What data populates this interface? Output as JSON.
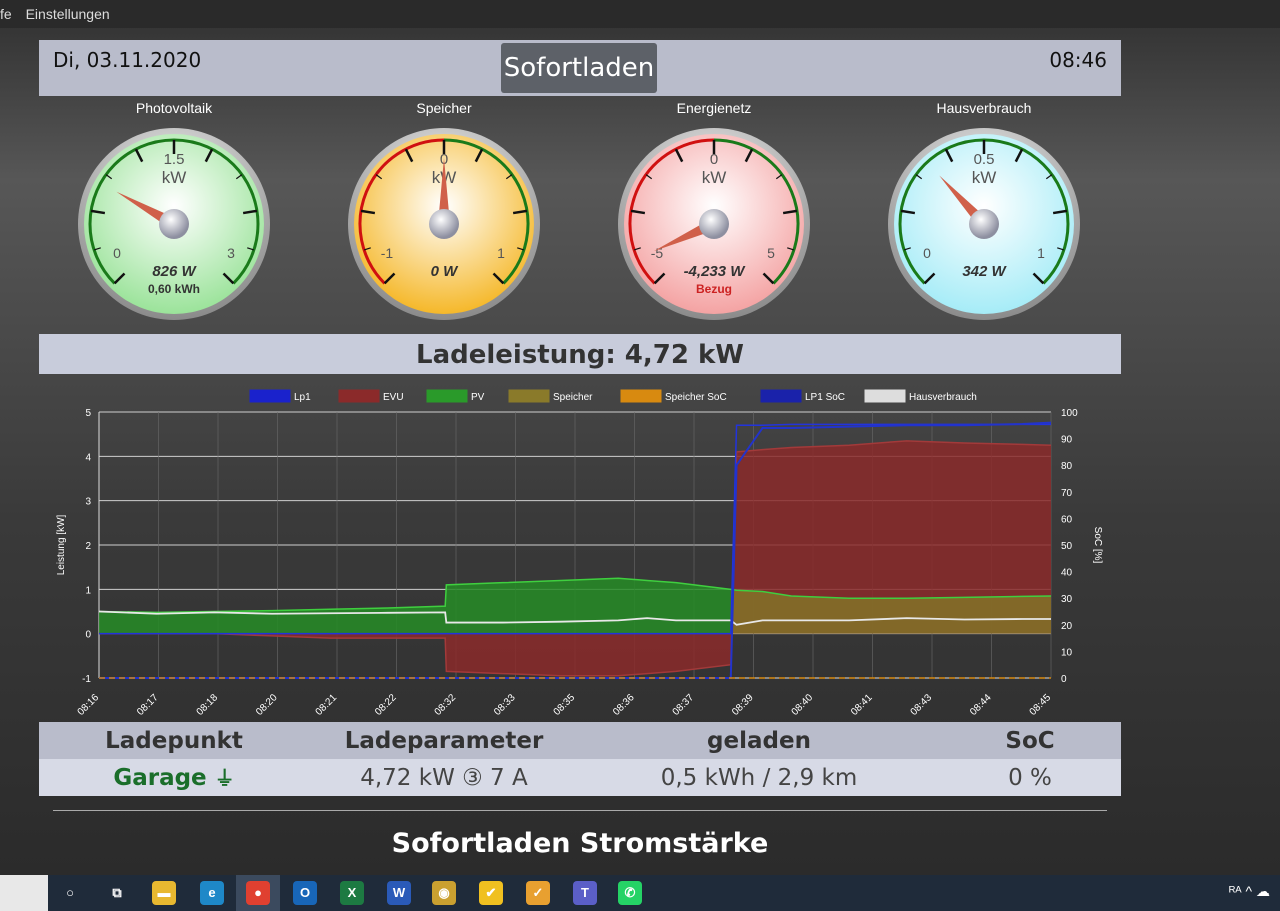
{
  "menu": {
    "item1": "fe",
    "item2": "Einstellungen"
  },
  "header": {
    "date": "Di, 03.11.2020",
    "mode_button": "Sofortladen",
    "time": "08:46"
  },
  "gauges": [
    {
      "title": "Photovoltaik",
      "center_value": "1.5",
      "unit": "kW",
      "min": "0",
      "max": "3",
      "value": "826 W",
      "extra": "0,60 kWh",
      "needle_fraction": 0.275,
      "face_color": "#9be39a",
      "extra_color": "#333333"
    },
    {
      "title": "Speicher",
      "center_value": "0",
      "unit": "kW",
      "min": "-1",
      "max": "1",
      "value": "0 W",
      "extra": "",
      "needle_fraction": 0.5,
      "face_color": "#f5b82a",
      "extra_color": "#333333"
    },
    {
      "title": "Energienetz",
      "center_value": "0",
      "unit": "kW",
      "min": "-5",
      "max": "5",
      "value": "-4,233 W",
      "extra": "Bezug",
      "needle_fraction": 0.077,
      "face_color": "#f4a3a3",
      "extra_color": "#cc2222"
    },
    {
      "title": "Hausverbrauch",
      "center_value": "0.5",
      "unit": "kW",
      "min": "0",
      "max": "1",
      "value": "342 W",
      "extra": "",
      "needle_fraction": 0.342,
      "face_color": "#a6ecf7",
      "extra_color": "#333333"
    }
  ],
  "banner": {
    "text": "Ladeleistung: 4,72 kW"
  },
  "chart_data": {
    "type": "area",
    "legend": [
      {
        "name": "Lp1",
        "color": "#1a22cc"
      },
      {
        "name": "EVU",
        "color": "#8b2a2a"
      },
      {
        "name": "PV",
        "color": "#2a9a2a"
      },
      {
        "name": "Speicher",
        "color": "#8a7a2a"
      },
      {
        "name": "Speicher SoC",
        "color": "#d88a10"
      },
      {
        "name": "LP1 SoC",
        "color": "#1a22aa"
      },
      {
        "name": "Hausverbrauch",
        "color": "#dddddd"
      }
    ],
    "ylabel": "Leistung [kW]",
    "y2label": "SoC [%]",
    "ylim": [
      -1,
      5
    ],
    "y2lim": [
      0,
      100
    ],
    "yticks": [
      "-1",
      "0",
      "1",
      "2",
      "3",
      "4",
      "5"
    ],
    "y2ticks": [
      "0",
      "10",
      "20",
      "30",
      "40",
      "50",
      "60",
      "70",
      "80",
      "90",
      "100"
    ],
    "xticks": [
      "08:16",
      "08:17",
      "08:18",
      "08:20",
      "08:21",
      "08:22",
      "08:32",
      "08:33",
      "08:35",
      "08:36",
      "08:37",
      "08:39",
      "08:40",
      "08:41",
      "08:43",
      "08:44",
      "08:45"
    ],
    "x": [
      0,
      1,
      2,
      3,
      4,
      5,
      6,
      6.02,
      7,
      8,
      9,
      9.5,
      10,
      10.95,
      11.05,
      11.5,
      12,
      13,
      14,
      15,
      16,
      16.5
    ],
    "series": {
      "PV": [
        0.5,
        0.48,
        0.5,
        0.52,
        0.55,
        0.58,
        0.62,
        1.1,
        1.15,
        1.2,
        1.25,
        1.2,
        1.15,
        1.0,
        0.98,
        0.95,
        0.85,
        0.8,
        0.8,
        0.82,
        0.84,
        0.85
      ],
      "EVU": [
        0.0,
        0.0,
        0.0,
        -0.05,
        -0.1,
        -0.1,
        -0.1,
        -0.85,
        -0.9,
        -0.95,
        -0.95,
        -0.9,
        -0.85,
        -0.7,
        4.1,
        4.15,
        4.2,
        4.25,
        4.35,
        4.3,
        4.27,
        4.25
      ],
      "Hausverbrauch": [
        0.5,
        0.45,
        0.48,
        0.45,
        0.46,
        0.47,
        0.48,
        0.25,
        0.25,
        0.27,
        0.3,
        0.35,
        0.3,
        0.3,
        0.2,
        0.3,
        0.3,
        0.3,
        0.35,
        0.32,
        0.33,
        0.33
      ],
      "Lp1": [
        0,
        0,
        0,
        0,
        0,
        0,
        0,
        0,
        0,
        0,
        0,
        0,
        0,
        0,
        4.7,
        4.7,
        4.72,
        4.72,
        4.72,
        4.72,
        4.72,
        4.72
      ],
      "LP1 SoC": [
        0,
        0,
        0,
        0,
        0,
        0,
        0,
        0,
        0,
        0,
        0,
        0,
        0,
        0,
        80,
        94,
        94,
        94.5,
        95,
        95,
        95.5,
        96
      ],
      "Speicher": [
        0,
        0,
        0,
        0,
        0,
        0,
        0,
        0,
        0,
        0,
        0,
        0,
        0,
        0,
        0,
        0,
        0,
        0,
        0,
        0,
        0,
        0
      ]
    }
  },
  "table": {
    "headers": [
      "Ladepunkt",
      "Ladeparameter",
      "geladen",
      "SoC"
    ],
    "row": {
      "ladepunkt": "Garage",
      "plug_icon": "⏚",
      "parameter": "4,72 kW ③ 7 A",
      "geladen": "0,5 kWh / 2,9 km",
      "soc": "0 %"
    }
  },
  "subheading": "Sofortladen Stromstärke",
  "taskbar": {
    "icons": [
      {
        "name": "search-icon",
        "glyph": "○",
        "color": "transparent"
      },
      {
        "name": "task-view-icon",
        "glyph": "⧉",
        "color": "transparent"
      },
      {
        "name": "file-explorer-icon",
        "glyph": "▬",
        "color": "#e8b830"
      },
      {
        "name": "edge-icon",
        "glyph": "e",
        "color": "#1e88c8"
      },
      {
        "name": "chrome-icon",
        "glyph": "●",
        "color": "#e04030"
      },
      {
        "name": "outlook-icon",
        "glyph": "O",
        "color": "#1866b8"
      },
      {
        "name": "excel-icon",
        "glyph": "X",
        "color": "#1d7a42"
      },
      {
        "name": "word-icon",
        "glyph": "W",
        "color": "#2a5ab8"
      },
      {
        "name": "teams-meeting-icon",
        "glyph": "◉",
        "color": "#caa030"
      },
      {
        "name": "norton-icon",
        "glyph": "✔",
        "color": "#f0c020"
      },
      {
        "name": "todo-icon",
        "glyph": "✓",
        "color": "#e8a030"
      },
      {
        "name": "teams-icon",
        "glyph": "T",
        "color": "#5b5fc7"
      },
      {
        "name": "whatsapp-icon",
        "glyph": "✆",
        "color": "#25d366"
      }
    ],
    "tray": "ᴿᴬ  ^  ☁"
  }
}
